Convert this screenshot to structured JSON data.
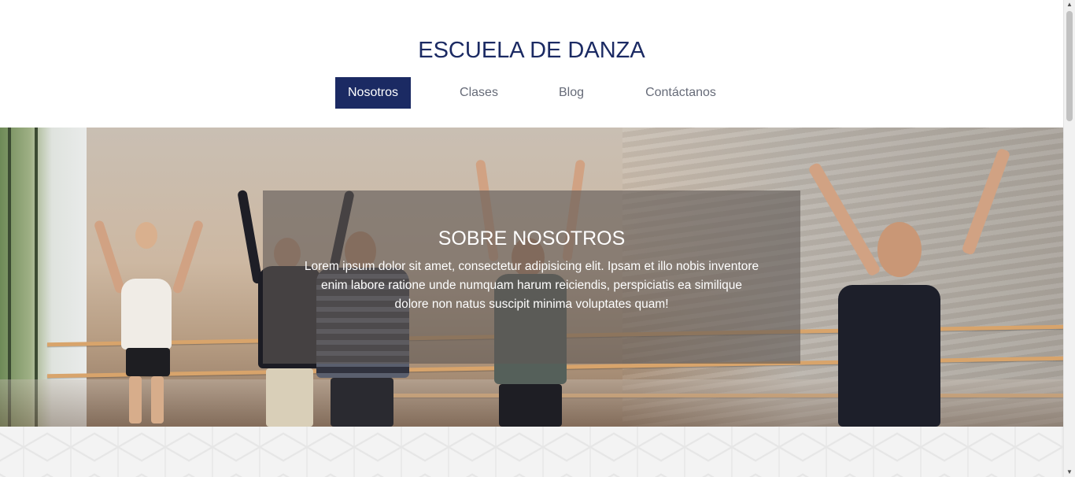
{
  "header": {
    "title": "ESCUELA DE DANZA"
  },
  "nav": {
    "items": [
      {
        "label": "Nosotros",
        "active": true
      },
      {
        "label": "Clases",
        "active": false
      },
      {
        "label": "Blog",
        "active": false
      },
      {
        "label": "Contáctanos",
        "active": false
      }
    ]
  },
  "hero": {
    "title": "SOBRE NOSOTROS",
    "text": "Lorem ipsum dolor sit amet, consectetur adipisicing elit. Ipsam et illo nobis inventore enim labore ratione unde numquam harum reiciendis, perspiciatis ea similique dolore non natus suscipit minima voluptates quam!",
    "image": "ballet-class-photo"
  },
  "colors": {
    "brand": "#1b2a63",
    "nav_text": "#666b78",
    "overlay": "#5f5855"
  },
  "icons": {
    "scroll_up": "arrow-up-icon",
    "scroll_down": "arrow-down-icon"
  }
}
